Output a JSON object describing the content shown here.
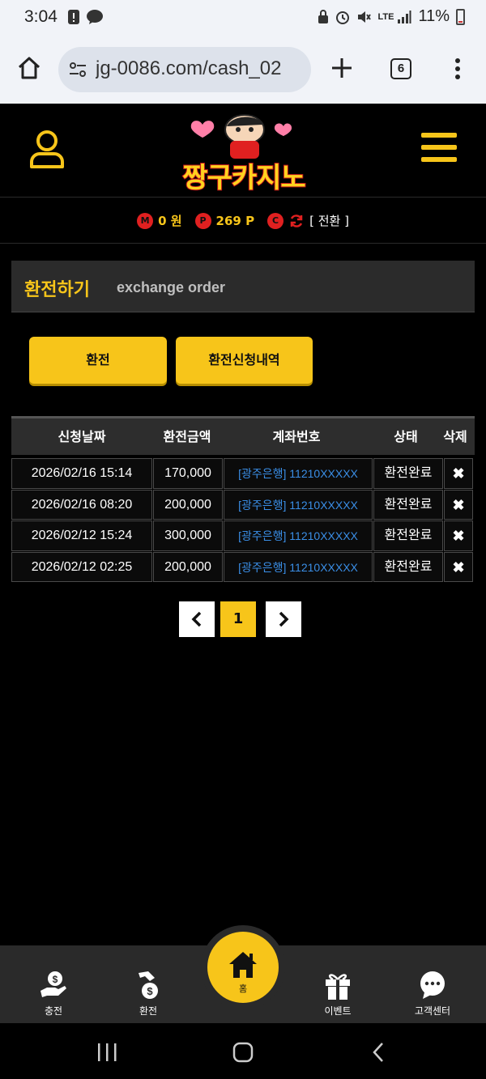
{
  "status_bar": {
    "time": "3:04",
    "battery": "11%",
    "network": "LTE",
    "icons": [
      "alert-icon",
      "talk-icon",
      "lock-icon",
      "alarm-icon",
      "mute-icon",
      "lte-icon",
      "signal-icon",
      "battery-icon"
    ]
  },
  "browser": {
    "url": "jg-0086.com/cash_02",
    "tab_count": "6"
  },
  "header": {
    "logo_text": "짱구카지노"
  },
  "balance": {
    "money_badge": "M",
    "money": "0 원",
    "point_badge": "P",
    "points": "269 P",
    "convert_badge": "C",
    "convert_label": "[ 전환 ]"
  },
  "section": {
    "title_ko": "환전하기",
    "title_en": "exchange order"
  },
  "buttons": {
    "exchange": "환전",
    "history": "환전신청내역"
  },
  "table": {
    "headers": [
      "신청날짜",
      "환전금액",
      "계좌번호",
      "상태",
      "삭제"
    ],
    "rows": [
      {
        "date": "2026/02/16 15:14",
        "amount": "170,000",
        "account": "[광주은행] 11210XXXXX",
        "status": "환전완료",
        "delete": "✖"
      },
      {
        "date": "2026/02/16 08:20",
        "amount": "200,000",
        "account": "[광주은행] 11210XXXXX",
        "status": "환전완료",
        "delete": "✖"
      },
      {
        "date": "2026/02/12 15:24",
        "amount": "300,000",
        "account": "[광주은행] 11210XXXXX",
        "status": "환전완료",
        "delete": "✖"
      },
      {
        "date": "2026/02/12 02:25",
        "amount": "200,000",
        "account": "[광주은행] 11210XXXXX",
        "status": "환전완료",
        "delete": "✖"
      }
    ]
  },
  "pagination": {
    "prev": "‹",
    "current": "1",
    "next": "›"
  },
  "bottom_nav": {
    "deposit": "충전",
    "withdraw": "환전",
    "home": "홈",
    "event": "이벤트",
    "support": "고객센터"
  },
  "colors": {
    "accent": "#f7c51a",
    "link": "#3a8ee6",
    "badge_red": "#e02020",
    "panel": "#2b2b2b"
  }
}
